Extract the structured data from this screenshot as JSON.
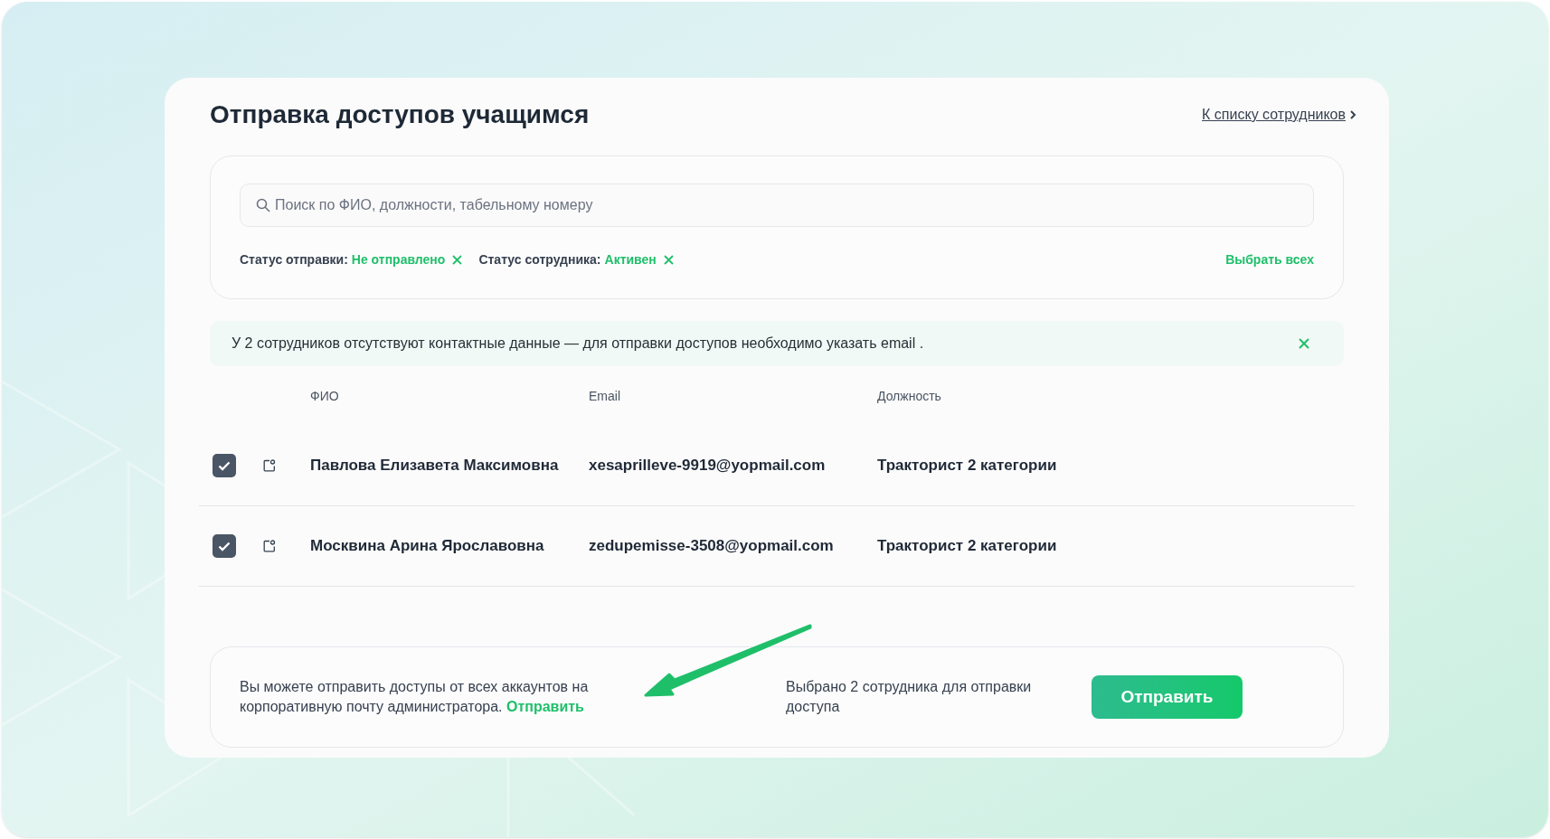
{
  "title": "Отправка доступов учащимся",
  "back_link": "К списку сотрудников",
  "search": {
    "placeholder": "Поиск по ФИО, должности, табельному номеру"
  },
  "filters": [
    {
      "label": "Статус отправки:",
      "value": "Не отправлено"
    },
    {
      "label": "Статус сотрудника:",
      "value": "Активен"
    }
  ],
  "select_all": "Выбрать всех",
  "alert": {
    "text": "У 2 сотрудников отсутствуют контактные данные — для отправки доступов необходимо указать email ."
  },
  "table": {
    "columns": [
      "ФИО",
      "Email",
      "Должность"
    ],
    "rows": [
      {
        "checked": true,
        "name": "Павлова Елизавета Максимовна",
        "email": "xesaprilleve-9919@yopmail.com",
        "position": "Тракторист 2 категории"
      },
      {
        "checked": true,
        "name": "Москвина Арина Ярославовна",
        "email": "zedupemisse-3508@yopmail.com",
        "position": "Тракторист 2 категории"
      }
    ]
  },
  "footer": {
    "note": "Вы можете отправить доступы от всех аккаунтов на корпоративную почту администратора.",
    "note_link": "Отправить",
    "selected_text": "Выбрано 2 сотрудника для отправки доступа",
    "button": "Отправить"
  }
}
